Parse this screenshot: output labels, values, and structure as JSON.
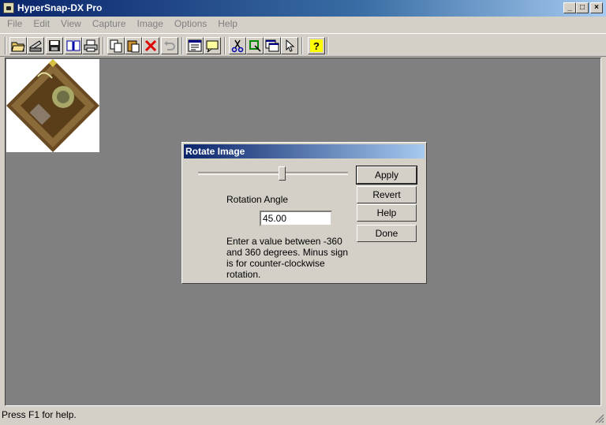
{
  "window": {
    "title": "HyperSnap-DX Pro"
  },
  "titlebar_buttons": [
    "_",
    "□",
    "×"
  ],
  "menu": [
    "File",
    "Edit",
    "View",
    "Capture",
    "Image",
    "Options",
    "Help"
  ],
  "toolbar_icons": [
    "open-icon",
    "scan-icon",
    "save-icon",
    "book-icon",
    "print-icon",
    "copy-icon",
    "paste-icon",
    "delete-icon",
    "undo-icon",
    "edit-icon",
    "note-icon",
    "cut-icon",
    "crop-icon",
    "window-icon",
    "pointer-icon",
    "help-icon"
  ],
  "dialog": {
    "title": "Rotate Image",
    "rotation_label": "Rotation Angle",
    "rotation_value": "45.00",
    "slider_value_deg": 45,
    "help_text": "Enter a value between -360 and 360 degrees. Minus sign is for counter-clockwise rotation.",
    "buttons": {
      "apply": "Apply",
      "revert": "Revert",
      "help": "Help",
      "done": "Done"
    }
  },
  "status": {
    "text": "Press F1 for help."
  }
}
